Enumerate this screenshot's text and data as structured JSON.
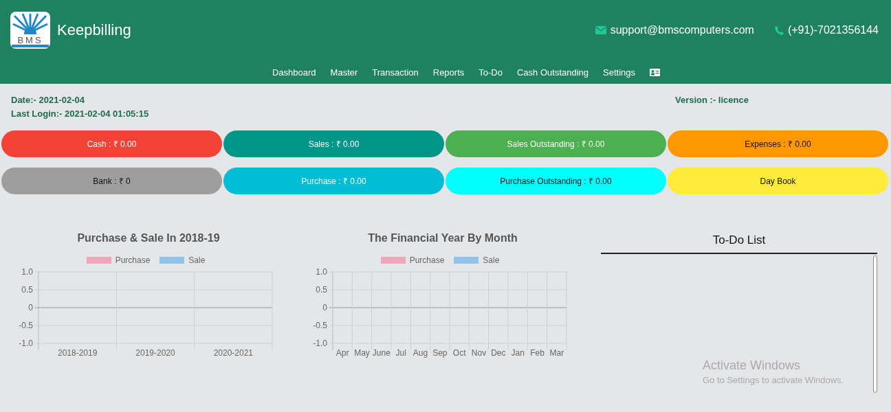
{
  "header": {
    "logo_text": "BMS",
    "brand": "Keepbilling",
    "email": "support@bmscomputers.com",
    "phone": "(+91)-7021356144",
    "nav": [
      {
        "label": "Dashboard",
        "kind": "text"
      },
      {
        "label": "Master",
        "kind": "text"
      },
      {
        "label": "Transaction",
        "kind": "text"
      },
      {
        "label": "Reports",
        "kind": "text"
      },
      {
        "label": "To-Do",
        "kind": "text"
      },
      {
        "label": "Cash Outstanding",
        "kind": "text"
      },
      {
        "label": "Settings",
        "kind": "text"
      },
      {
        "kind": "icon"
      }
    ]
  },
  "info": {
    "date": "Date:- 2021-02-04",
    "last_login": "Last Login:- 2021-02-04 01:05:15",
    "version": "Version :- licence"
  },
  "tiles": [
    {
      "label": "Cash : ₹ 0.00",
      "color": "#f44336"
    },
    {
      "label": "Sales : ₹ 0.00",
      "color": "#009688"
    },
    {
      "label": "Sales Outstanding : ₹ 0.00",
      "color": "#4caf50"
    },
    {
      "label": "Expenses : ₹ 0.00",
      "color": "#ff9800"
    },
    {
      "label": "Bank : ₹ 0",
      "color": "#9e9e9e"
    },
    {
      "label": "Purchase : ₹ 0.00",
      "color": "#00bcd4"
    },
    {
      "label": "Purchase Outstanding : ₹ 0.00",
      "color": "#00ffff"
    },
    {
      "label": "Day Book",
      "color": "#ffeb3b"
    }
  ],
  "charts": [
    {
      "chart_data": {
        "type": "bar",
        "title": "Purchase & Sale In 2018-19",
        "categories": [
          "2018-2019",
          "2019-2020",
          "2020-2021"
        ],
        "series": [
          {
            "name": "Purchase",
            "color": "#f3a6b8",
            "values": [
              null,
              null,
              null
            ]
          },
          {
            "name": "Sale",
            "color": "#8fc5ec",
            "values": [
              null,
              null,
              null
            ]
          }
        ],
        "ylim": [
          -1,
          1
        ],
        "yticks": [
          {
            "value": 1,
            "label": "1.0"
          },
          {
            "value": 0.5,
            "label": "0.5"
          },
          {
            "value": 0,
            "label": "0"
          },
          {
            "value": -0.5,
            "label": "-0.5"
          },
          {
            "value": -1,
            "label": "-1.0"
          }
        ]
      }
    },
    {
      "chart_data": {
        "type": "bar",
        "title": "The Financial Year By Month",
        "categories": [
          "Apr",
          "May",
          "June",
          "Jul",
          "Aug",
          "Sep",
          "Oct",
          "Nov",
          "Dec",
          "Jan",
          "Feb",
          "Mar"
        ],
        "series": [
          {
            "name": "Purchase",
            "color": "#f3a6b8",
            "values": [
              null,
              null,
              null,
              null,
              null,
              null,
              null,
              null,
              null,
              null,
              null,
              null
            ]
          },
          {
            "name": "Sale",
            "color": "#8fc5ec",
            "values": [
              null,
              null,
              null,
              null,
              null,
              null,
              null,
              null,
              null,
              null,
              null,
              null
            ]
          }
        ],
        "ylim": [
          -1,
          1
        ],
        "yticks": [
          {
            "value": 1,
            "label": "1.0"
          },
          {
            "value": 0.5,
            "label": "0.5"
          },
          {
            "value": 0,
            "label": "0"
          },
          {
            "value": -0.5,
            "label": "-0.5"
          },
          {
            "value": -1,
            "label": "-1.0"
          }
        ]
      }
    }
  ],
  "todo": {
    "title": "To-Do List"
  },
  "os_overlay": {
    "title": "Activate Windows",
    "subtitle": "Go to Settings to activate Windows."
  }
}
